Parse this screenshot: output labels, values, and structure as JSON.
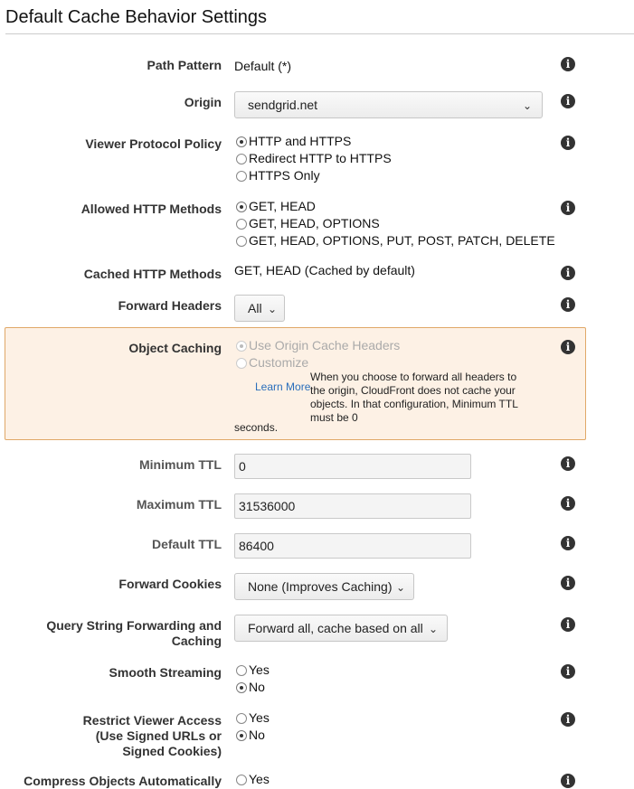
{
  "title": "Default Cache Behavior Settings",
  "path_pattern": {
    "label": "Path Pattern",
    "value": "Default (*)"
  },
  "origin": {
    "label": "Origin",
    "value": "sendgrid.net"
  },
  "viewer_protocol": {
    "label": "Viewer Protocol Policy",
    "options": [
      "HTTP and HTTPS",
      "Redirect HTTP to HTTPS",
      "HTTPS Only"
    ],
    "selected": 0
  },
  "allowed_methods": {
    "label": "Allowed HTTP Methods",
    "options": [
      "GET, HEAD",
      "GET, HEAD, OPTIONS",
      "GET, HEAD, OPTIONS, PUT, POST, PATCH, DELETE"
    ],
    "selected": 0
  },
  "cached_methods": {
    "label": "Cached HTTP Methods",
    "value": "GET, HEAD (Cached by default)"
  },
  "forward_headers": {
    "label": "Forward Headers",
    "value": "All"
  },
  "object_caching": {
    "label": "Object Caching",
    "options": [
      "Use Origin Cache Headers",
      "Customize"
    ],
    "selected": 0,
    "learn_more": "Learn More",
    "note": "When you choose to forward all headers to the origin, CloudFront does not cache your objects. In that configuration, Minimum TTL must be 0",
    "note_tail": "seconds."
  },
  "min_ttl": {
    "label": "Minimum TTL",
    "value": "0"
  },
  "max_ttl": {
    "label": "Maximum TTL",
    "value": "31536000"
  },
  "default_ttl": {
    "label": "Default TTL",
    "value": "86400"
  },
  "forward_cookies": {
    "label": "Forward Cookies",
    "value": "None (Improves Caching)"
  },
  "query_string": {
    "label_line1": "Query String Forwarding and",
    "label_line2": "Caching",
    "value": "Forward all, cache based on all"
  },
  "smooth_streaming": {
    "label": "Smooth Streaming",
    "options": [
      "Yes",
      "No"
    ],
    "selected": 1
  },
  "restrict_access": {
    "label_line1": "Restrict Viewer Access",
    "label_line2": "(Use Signed URLs or",
    "label_line3": "Signed Cookies)",
    "options": [
      "Yes",
      "No"
    ],
    "selected": 1
  },
  "compress": {
    "label": "Compress Objects Automatically",
    "options": [
      "Yes"
    ]
  },
  "info_icon_glyph": "i",
  "colors": {
    "warning_bg": "#fdf1e5",
    "warning_border": "#e0a868",
    "link": "#2a6ebb"
  }
}
